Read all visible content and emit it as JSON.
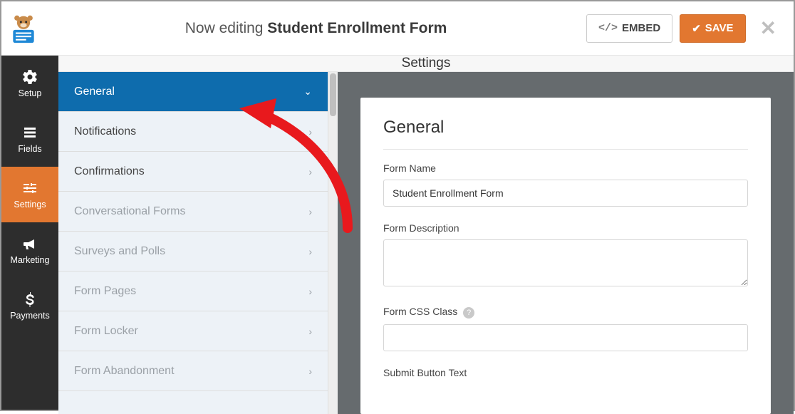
{
  "header": {
    "editing_prefix": "Now editing ",
    "form_title": "Student Enrollment Form",
    "embed_label": "EMBED",
    "save_label": "SAVE"
  },
  "rail": {
    "setup": "Setup",
    "fields": "Fields",
    "settings": "Settings",
    "marketing": "Marketing",
    "payments": "Payments"
  },
  "page_title": "Settings",
  "settings_nav": {
    "general": "General",
    "notifications": "Notifications",
    "confirmations": "Confirmations",
    "conversational": "Conversational Forms",
    "surveys": "Surveys and Polls",
    "formpages": "Form Pages",
    "formlocker": "Form Locker",
    "formabandon": "Form Abandonment"
  },
  "panel": {
    "heading": "General",
    "form_name_label": "Form Name",
    "form_name_value": "Student Enrollment Form",
    "form_description_label": "Form Description",
    "form_description_value": "",
    "form_css_label": "Form CSS Class",
    "form_css_value": "",
    "submit_button_label": "Submit Button Text"
  }
}
